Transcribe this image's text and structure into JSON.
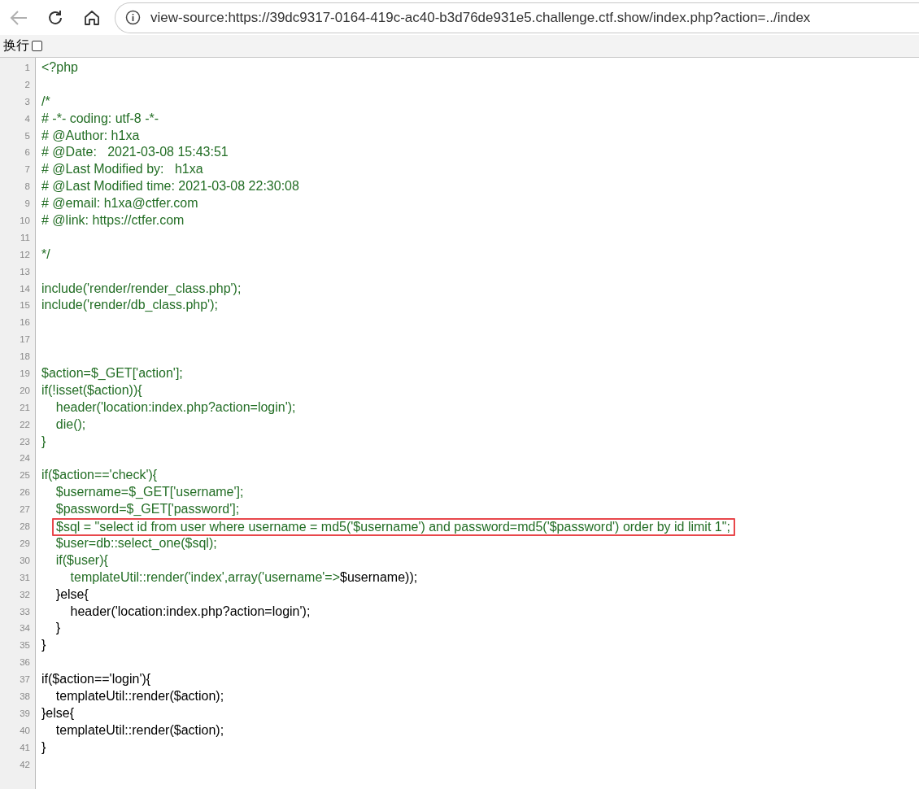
{
  "toolbar": {
    "address": "view-source:https://39dc9317-0164-419c-ac40-b3d76de931e5.challenge.ctf.show/index.php?action=../index"
  },
  "wrap_option": {
    "label": "换行",
    "checked": false
  },
  "lines": [
    {
      "number": "1",
      "kind": "comment",
      "text": "<?php"
    },
    {
      "number": "2"
    },
    {
      "number": "3",
      "kind": "comment",
      "text": "/*"
    },
    {
      "number": "4",
      "kind": "comment",
      "text": "# -*- coding: utf-8 -*-"
    },
    {
      "number": "5",
      "kind": "comment",
      "text": "# @Author: h1xa"
    },
    {
      "number": "6",
      "kind": "comment",
      "text": "# @Date:   2021-03-08 15:43:51"
    },
    {
      "number": "7",
      "kind": "comment",
      "text": "# @Last Modified by:   h1xa"
    },
    {
      "number": "8",
      "kind": "comment",
      "text": "# @Last Modified time: 2021-03-08 22:30:08"
    },
    {
      "number": "9",
      "kind": "comment",
      "text": "# @email: h1xa@ctfer.com"
    },
    {
      "number": "10",
      "kind": "comment",
      "text": "# @link: https://ctfer.com"
    },
    {
      "number": "11"
    },
    {
      "number": "12",
      "kind": "comment",
      "text": "*/"
    },
    {
      "number": "13"
    },
    {
      "number": "14",
      "kind": "comment",
      "text": "include('render/render_class.php');"
    },
    {
      "number": "15",
      "kind": "comment",
      "text": "include('render/db_class.php');"
    },
    {
      "number": "16"
    },
    {
      "number": "17"
    },
    {
      "number": "18"
    },
    {
      "number": "19",
      "kind": "comment",
      "text": "$action=$_GET['action'];"
    },
    {
      "number": "20",
      "kind": "comment",
      "text": "if(!isset($action)){"
    },
    {
      "number": "21",
      "kind": "comment",
      "text": "    header('location:index.php?action=login');"
    },
    {
      "number": "22",
      "kind": "comment",
      "text": "    die();"
    },
    {
      "number": "23",
      "kind": "comment",
      "text": "}"
    },
    {
      "number": "24"
    },
    {
      "number": "25",
      "kind": "comment",
      "text": "if($action=='check'){"
    },
    {
      "number": "26",
      "kind": "comment",
      "text": "    $username=$_GET['username'];"
    },
    {
      "number": "27",
      "kind": "comment",
      "text": "    $password=$_GET['password'];"
    },
    {
      "number": "28",
      "kind": "comment",
      "highlighted": true,
      "text": "$sql = \"select id from user where username = md5('$username') and password=md5('$password') order by id limit 1\";"
    },
    {
      "number": "29",
      "kind": "comment",
      "text": "    $user=db::select_one($sql);"
    },
    {
      "number": "30",
      "kind": "comment",
      "text": "    if($user){"
    },
    {
      "number": "31",
      "kind": "mixed",
      "segments": [
        {
          "kind": "comment",
          "text": "        templateUtil::render('index',array('username'=>"
        },
        {
          "kind": "plain",
          "text": "$username));"
        }
      ]
    },
    {
      "number": "32",
      "kind": "plain",
      "text": "    }else{"
    },
    {
      "number": "33",
      "kind": "plain",
      "text": "        header('location:index.php?action=login');"
    },
    {
      "number": "34",
      "kind": "plain",
      "text": "    }"
    },
    {
      "number": "35",
      "kind": "plain",
      "text": "}"
    },
    {
      "number": "36"
    },
    {
      "number": "37",
      "kind": "plain",
      "text": "if($action=='login'){"
    },
    {
      "number": "38",
      "kind": "plain",
      "text": "    templateUtil::render($action);"
    },
    {
      "number": "39",
      "kind": "plain",
      "text": "}else{"
    },
    {
      "number": "40",
      "kind": "plain",
      "text": "    templateUtil::render($action);"
    },
    {
      "number": "41",
      "kind": "plain",
      "text": "}"
    },
    {
      "number": "42"
    }
  ]
}
